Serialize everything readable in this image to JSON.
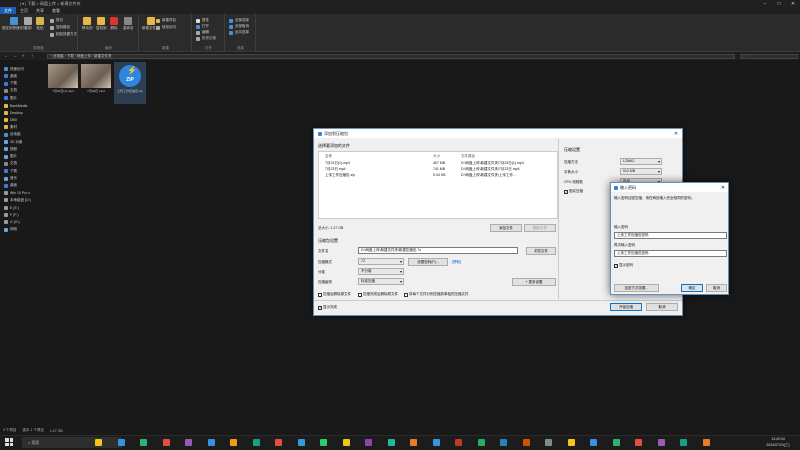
{
  "explorer": {
    "title": "| ▾ | 下载 > 网盘上传 > 新建文件夹",
    "ribbon_tabs": [
      "文件",
      "主页",
      "共享",
      "查看"
    ],
    "ribbon_groups": [
      {
        "label": "剪贴板",
        "items": [
          "固定到快速访问",
          "复制",
          "粘贴",
          "剪切",
          "复制路径",
          "粘贴快捷方式"
        ]
      },
      {
        "label": "组织",
        "items": [
          "移动到",
          "复制到",
          "删除",
          "重命名"
        ]
      },
      {
        "label": "新建",
        "items": [
          "新建文件夹",
          "新建项目",
          "轻松访问"
        ]
      },
      {
        "label": "打开",
        "items": [
          "属性",
          "打开",
          "编辑",
          "历史记录"
        ]
      },
      {
        "label": "选择",
        "items": [
          "全部选择",
          "全部取消",
          "反向选择"
        ]
      }
    ],
    "address": "› 此电脑 › 下载 › 网盘上传 › 新建文件夹",
    "search_placeholder": "",
    "sidebar": [
      {
        "label": "快速访问",
        "icon": "star-icon",
        "color": "#4a90d9"
      },
      {
        "label": "桌面",
        "icon": "desktop-icon",
        "color": "#3b7dd8"
      },
      {
        "label": "下载",
        "icon": "download-icon",
        "color": "#3b7dd8"
      },
      {
        "label": "文档",
        "icon": "document-icon",
        "color": "#8a8a8a"
      },
      {
        "label": "图片",
        "icon": "picture-icon",
        "color": "#3b7dd8"
      },
      {
        "label": "BackMedia",
        "icon": "folder-icon",
        "color": "#e6b84a"
      },
      {
        "label": "Desktop",
        "icon": "folder-icon",
        "color": "#e6b84a"
      },
      {
        "label": "DBX",
        "icon": "folder-icon",
        "color": "#e6b84a"
      },
      {
        "label": "素材",
        "icon": "folder-icon",
        "color": "#e6b84a"
      },
      {
        "label": "此电脑",
        "icon": "computer-icon",
        "color": "#4a90d9"
      },
      {
        "label": "3D 对象",
        "icon": "cube-icon",
        "color": "#6aa5e0"
      },
      {
        "label": "视频",
        "icon": "video-icon",
        "color": "#6aa5e0"
      },
      {
        "label": "图片",
        "icon": "picture-icon",
        "color": "#6aa5e0"
      },
      {
        "label": "文档",
        "icon": "document-icon",
        "color": "#8a8a8a"
      },
      {
        "label": "下载",
        "icon": "download-icon",
        "color": "#3b7dd8"
      },
      {
        "label": "音乐",
        "icon": "music-icon",
        "color": "#6aa5e0"
      },
      {
        "label": "桌面",
        "icon": "desktop-icon",
        "color": "#3b7dd8"
      },
      {
        "label": "Win 10 Pro x",
        "icon": "drive-icon",
        "color": "#9a9a9a"
      },
      {
        "label": "本地磁盘 (D:)",
        "icon": "drive-icon",
        "color": "#9a9a9a"
      },
      {
        "label": "E (E:)",
        "icon": "drive-icon",
        "color": "#9a9a9a"
      },
      {
        "label": "F (F:)",
        "icon": "drive-icon",
        "color": "#9a9a9a"
      },
      {
        "label": "G (G:)",
        "icon": "drive-icon",
        "color": "#9a9a9a"
      },
      {
        "label": "网络",
        "icon": "network-icon",
        "color": "#6aa5e0"
      }
    ],
    "files": [
      {
        "name": "7月23日(1).mp4",
        "kind": "video"
      },
      {
        "name": "7月23日.mp4",
        "kind": "video"
      },
      {
        "name": "上传工作压缩包.zip",
        "kind": "zip"
      }
    ],
    "zip_label": "ZIP",
    "status": [
      "3 个项目",
      "选中 1 个项目",
      "1.27 GB"
    ]
  },
  "archive_dialog": {
    "title": "添加到压缩包",
    "section_files": "选择要添加的文件",
    "columns": [
      "名称",
      "大小",
      "文件路径"
    ],
    "rows": [
      {
        "name": "7月23日(1).mp4",
        "size": "467 MB",
        "path": "D:\\网盘上传\\新建文件夹\\7月23日(1).mp4"
      },
      {
        "name": "7月23日.mp4",
        "size": "741 MB",
        "path": "D:\\网盘上传\\新建文件夹\\7月23日.mp4"
      },
      {
        "name": "上传工作压缩包.zip",
        "size": "5.34 KB",
        "path": "D:\\网盘上传\\新建文件夹\\上传工作..."
      }
    ],
    "total": "总大小: 1.27 GB",
    "add_button": "添加文件",
    "remove_button": "删除文件",
    "section_settings": "压缩包设置",
    "archive_name_label": "文件名",
    "archive_name": "D:\\网盘上传\\新建文件夹\\新建压缩包.7z",
    "browse_button": "浏览文件",
    "format_label": "压缩格式",
    "format": "7Z",
    "set_password_button": "设置密码(P)...",
    "password_hint": "[帮助]",
    "volume_label": "分卷",
    "volume": "不分卷",
    "method_label": "压缩级别",
    "method": "标准压缩",
    "more_button": "+ 更多设置",
    "opts": [
      "压缩后删除源文件",
      "压缩完成后删除原文件",
      "将每个文件分别压缩到单独的压缩文件"
    ],
    "section_advanced": "压缩设置",
    "adv": [
      {
        "label": "压缩方法",
        "value": "LZMA2"
      },
      {
        "label": "字典大小",
        "value": "512 MB"
      },
      {
        "label": "CPU 线程数",
        "value": "自动"
      }
    ],
    "adv_check": "固实压缩",
    "footer_check": "显示完成",
    "start_button": "开始压缩",
    "cancel_button": "取消"
  },
  "password_dialog": {
    "title": "输入密码",
    "description": "输入密码加密压缩，请在两处输入完全相同的密码。",
    "pw_label": "输入密码",
    "pw_value": "上传工作压缩包密码",
    "confirm_label": "再次输入密码",
    "confirm_value": "上传工作压缩包密码",
    "show_password": "显示密码",
    "manage_button": "加密方式设置...",
    "ok_button": "确定",
    "cancel_button": "取消"
  },
  "taskbar": {
    "search": "搜索",
    "time": "13:40:34",
    "date": "2024/07/24(三)"
  }
}
